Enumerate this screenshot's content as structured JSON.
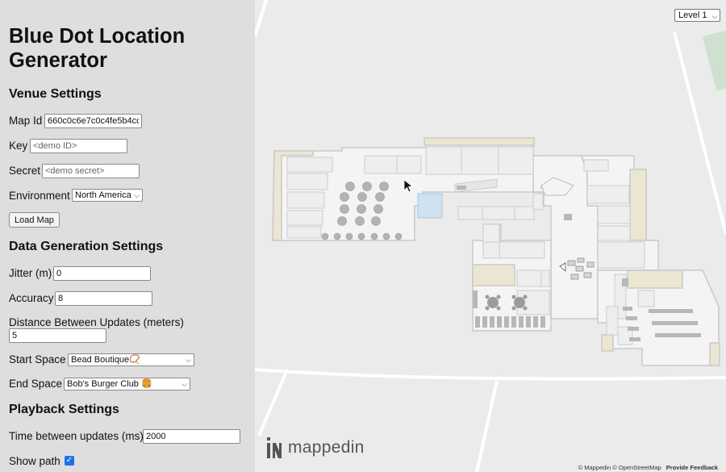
{
  "app": {
    "title": "Blue Dot Location Generator"
  },
  "venue": {
    "heading": "Venue Settings",
    "map_id_label": "Map Id",
    "map_id_value": "660c0c6e7c0c4fe5b4cc",
    "key_label": "Key",
    "key_placeholder": "<demo ID>",
    "secret_label": "Secret",
    "secret_placeholder": "<demo secret>",
    "environment_label": "Environment",
    "environment_value": "North America",
    "load_button": "Load Map"
  },
  "generation": {
    "heading": "Data Generation Settings",
    "jitter_label": "Jitter (m)",
    "jitter_value": "0",
    "accuracy_label": "Accuracy",
    "accuracy_value": "8",
    "distance_label": "Distance Between Updates (meters)",
    "distance_value": "5",
    "start_label": "Start Space",
    "start_value": "Bead Boutique📿",
    "end_label": "End Space",
    "end_value": "Bob's Burger Club 🍔"
  },
  "playback": {
    "heading": "Playback Settings",
    "interval_label": "Time between updates (ms)",
    "interval_value": "2000",
    "show_path_label": "Show path",
    "show_path_checked": true
  },
  "map": {
    "level_value": "Level 1",
    "logo_text": "mappedin",
    "attribution": "© Mappedin © OpenStreetMap",
    "feedback_link": "Provide Feedback"
  },
  "colors": {
    "panel_bg": "#dedede",
    "map_bg": "#ebebeb",
    "room_fill": "#f4f4f4",
    "wall": "#c9c9c9",
    "beige": "#ebe6d2",
    "highlight": "#cfe2f1",
    "accent": "#1a73e8"
  }
}
